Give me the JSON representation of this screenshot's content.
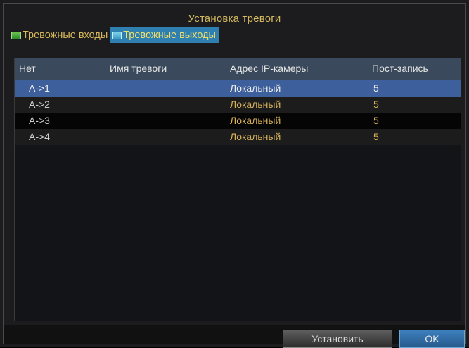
{
  "dialog": {
    "title": "Установка тревоги"
  },
  "tabs": [
    {
      "label": "Тревожные входы",
      "active": false,
      "icon": "alarm-input-icon"
    },
    {
      "label": "Тревожные выходы",
      "active": true,
      "icon": "alarm-output-icon"
    }
  ],
  "table": {
    "columns": [
      "Нет",
      "Имя тревоги",
      "Адрес IP-камеры",
      "Пост-запись"
    ],
    "rows": [
      {
        "no": "A->1",
        "name": "",
        "ip": "Локальный",
        "post": "5",
        "selected": true
      },
      {
        "no": "A->2",
        "name": "",
        "ip": "Локальный",
        "post": "5",
        "selected": false
      },
      {
        "no": "A->3",
        "name": "",
        "ip": "Локальный",
        "post": "5",
        "selected": false
      },
      {
        "no": "A->4",
        "name": "",
        "ip": "Локальный",
        "post": "5",
        "selected": false
      }
    ]
  },
  "buttons": {
    "setup": "Установить",
    "ok": "OK"
  },
  "colors": {
    "title": "#d2b85f",
    "active_tab": "#2f7fb0",
    "selected_row": "#3d5f9c",
    "header": "#3a4a5c"
  }
}
